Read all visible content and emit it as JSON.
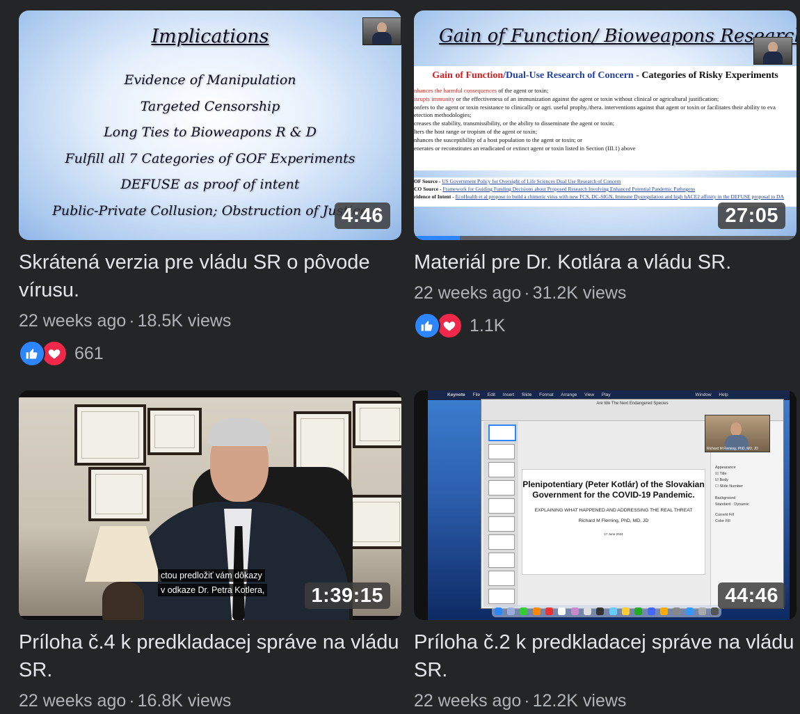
{
  "videos": [
    {
      "title": "Skrátená verzia pre vládu SR o pôvode vírusu.",
      "age": "22 weeks ago",
      "views": "18.5K views",
      "duration": "4:46",
      "reactions": "661",
      "slide": {
        "heading": "Implications",
        "lines": [
          "Evidence of Manipulation",
          "Targeted Censorship",
          "Long Ties to Bioweapons R & D",
          "Fulfill all 7 Categories of GOF Experiments",
          "DEFUSE as proof of intent",
          "Public-Private Collusion; Obstruction of Justice"
        ]
      }
    },
    {
      "title": "Materiál pre Dr. Kotlára a vládu SR.",
      "age": "22 weeks ago",
      "views": "31.2K views",
      "duration": "27:05",
      "reactions": "1.1K",
      "progress": 0.12,
      "slide": {
        "heading": "Gain of Function/ Bioweapons Research",
        "doc_title_red": "Gain of Function",
        "doc_title_blue": "/Dual-Use Research of Concern",
        "doc_title_rest": " - Categories of Risky Experiments",
        "rows": [
          {
            "red": "nhances the harmful consequences",
            "rest": " of the agent or toxin;"
          },
          {
            "red": "isrupts immunity",
            "rest": " or the effectiveness of an immunization against the agent or toxin without clinical or agricultural justification;"
          },
          {
            "red": "",
            "rest": "onfers to the agent or toxin resistance to clinically or agri. useful prophy./thera. interventions against that agent or toxin or facilitates their ability to eva"
          },
          {
            "red": "",
            "rest": "etection methodologies;"
          },
          {
            "red": "",
            "rest": "creases the stability, transmissibility, or the ability to disseminate the agent or toxin;"
          },
          {
            "red": "",
            "rest": "lters the host range or tropism of the agent or toxin;"
          },
          {
            "red": "",
            "rest": "nhances the susceptibility of a host population to the agent or toxin; or"
          },
          {
            "red": "",
            "rest": "enerates or reconstitutes an eradicated or extinct agent or toxin listed in Section (III.1) above"
          }
        ],
        "sources": [
          {
            "label": "OF Source - ",
            "text": "US Government Policy for Oversight of Life Sciences Dual Use Research of Concern"
          },
          {
            "label": "CO Source - ",
            "text": "Framework for Guiding Funding Decisions about Proposed Research Involving Enhanced Potential Pandemic Pathogens"
          },
          {
            "label": "ridence of Intent - ",
            "text": "EcoHealth et al propose to build a chimeric virus with new FCS, DC-SIGN, Immune Dysregulation and high hACE2 affinity in the DEFUSE proposal to DA"
          }
        ]
      }
    },
    {
      "title": "Príloha č.4 k predkladacej správe na vládu SR.",
      "age": "22 weeks ago",
      "views": "16.8K views",
      "duration": "1:39:15",
      "subtitles": [
        "ctou predložiť vám dôkazy",
        "v odkaze Dr. Petra Kotlera,"
      ]
    },
    {
      "title": "Príloha č.2 k predkladacej správe na vládu SR.",
      "age": "22 weeks ago",
      "views": "12.2K views",
      "duration": "44:46",
      "keynote": {
        "window_title": "Are We The Next Endangered Species",
        "menu": [
          "Keynote",
          "File",
          "Edit",
          "Insert",
          "Slide",
          "Format",
          "Arrange",
          "View",
          "Play",
          "Window",
          "Help"
        ],
        "slide_title": "Plenipotentiary (Peter Kotlár) of the Slovakian Government for the COVID-19 Pandemic.",
        "slide_subtitle": "EXPLAINING WHAT HAPPENED AND ADDRESSING THE REAL THREAT",
        "slide_author": "Richard M Fleming, PhD, MD, JD",
        "slide_date": "17 June 2024",
        "side_labels": [
          "Appearance",
          "Title",
          "Body",
          "Slide Number",
          "Background",
          "Standard",
          "Dynamic",
          "Current Fill",
          "Color Fill"
        ],
        "cam_label": "Richard M Fleming, PhD, MD, JD"
      }
    }
  ],
  "colors": {
    "background": "#242526",
    "text_primary": "#e4e6eb",
    "text_secondary": "#b0b3b8",
    "like": "#2d86ff",
    "love": "#f0284a"
  }
}
